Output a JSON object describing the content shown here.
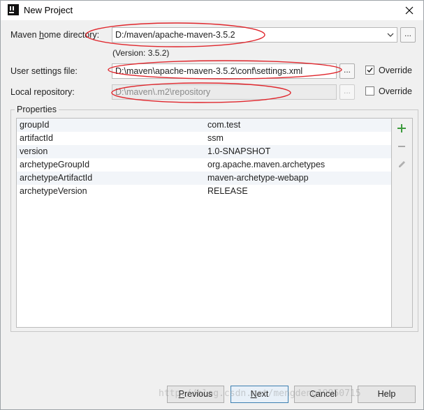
{
  "window": {
    "title": "New Project",
    "title_icon": "intellij-idea-icon",
    "close_icon": "close-icon"
  },
  "maven_home": {
    "label_pre": "Maven ",
    "label_mn": "h",
    "label_post": "ome directory:",
    "value": "D:/maven/apache-maven-3.5.2",
    "version": "(Version: 3.5.2)"
  },
  "user_settings": {
    "label": "User settings file:",
    "value": "D:\\maven\\apache-maven-3.5.2\\conf\\settings.xml",
    "override_label": "Override",
    "override_checked": true
  },
  "local_repo": {
    "label": "Local repository:",
    "value": "D:\\maven\\.m2\\repository",
    "override_label": "Override",
    "override_checked": false
  },
  "browse_label": "...",
  "properties": {
    "title": "Properties",
    "rows": [
      {
        "key": "groupId",
        "value": "com.test"
      },
      {
        "key": "artifactId",
        "value": "ssm"
      },
      {
        "key": "version",
        "value": "1.0-SNAPSHOT"
      },
      {
        "key": "archetypeGroupId",
        "value": "org.apache.maven.archetypes"
      },
      {
        "key": "archetypeArtifactId",
        "value": "maven-archetype-webapp"
      },
      {
        "key": "archetypeVersion",
        "value": "RELEASE"
      }
    ],
    "tools": [
      "add-icon",
      "remove-icon",
      "edit-icon"
    ],
    "accent_add": "#3c9a3c"
  },
  "buttons": {
    "previous": {
      "mn": "P",
      "rest": "revious"
    },
    "next": {
      "mn": "N",
      "rest": "ext"
    },
    "cancel": {
      "label": "Cancel"
    },
    "help": {
      "label": "Help"
    }
  },
  "watermark": "http://blog.csdn.net/mengdeng19950715"
}
